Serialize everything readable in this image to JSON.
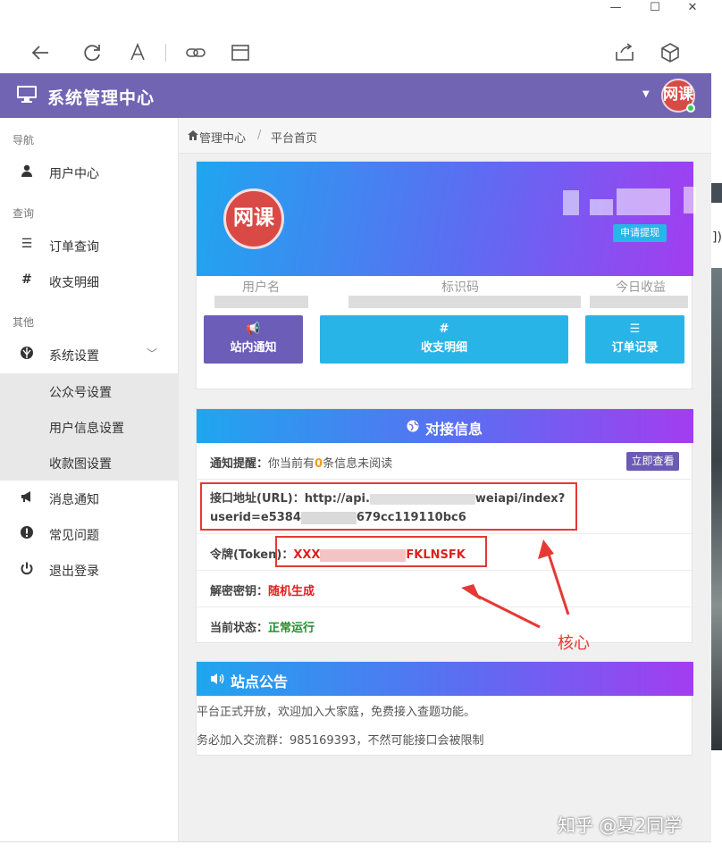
{
  "window": {
    "minimize": "—",
    "maximize": "☐",
    "close": "✕"
  },
  "app": {
    "title": "系统管理中心",
    "avatar_text": "网课"
  },
  "sidebar": {
    "sections": {
      "nav": "导航",
      "query": "查询",
      "other": "其他"
    },
    "items": {
      "user_center": "用户中心",
      "order_query": "订单查询",
      "finance": "收支明细",
      "settings": "系统设置",
      "wechat_settings": "公众号设置",
      "user_info_settings": "用户信息设置",
      "payment_qr_settings": "收款图设置",
      "messages": "消息通知",
      "faq": "常见问题",
      "logout": "退出登录"
    }
  },
  "breadcrumb": {
    "home": "管理中心",
    "sep": "/",
    "current": "平台首页"
  },
  "profile": {
    "logo_text": "网课",
    "withdraw_button": "申请提现",
    "labels": {
      "username": "用户名",
      "id_code": "标识码",
      "today_income": "今日收益"
    },
    "tiles": {
      "notice": {
        "icon": "📢",
        "label": "站内通知"
      },
      "finance": {
        "icon": "#",
        "label": "收支明细"
      },
      "orders": {
        "icon": "☰",
        "label": "订单记录"
      }
    }
  },
  "api_info": {
    "title": "对接信息",
    "notify_key": "通知提醒：",
    "notify_prefix": "你当前有",
    "notify_count": "0",
    "notify_suffix": "条信息未阅读",
    "view_button": "立即查看",
    "url_key": "接口地址(URL)：",
    "url_value_line1_start": "http://api.",
    "url_value_line1_end": "weiapi/index?",
    "url_value_line2_start": "userid=e5384",
    "url_value_line2_end": "679cc119110bc6",
    "token_key": "令牌(Token)：",
    "token_start": "XXX",
    "token_end": "FKLNSFK",
    "secret_key": "解密密钥：",
    "secret_value": "随机生成",
    "status_key": "当前状态：",
    "status_value": "正常运行"
  },
  "announcement": {
    "title": "站点公告",
    "lines": [
      "平台正式开放，欢迎加入大家庭，免费接入查题功能。",
      "务必加入交流群：985169393，不然可能接口会被限制"
    ]
  },
  "annotation": {
    "label": "核心"
  },
  "watermark": "知乎 @夏2同学",
  "right_strip_text": "])"
}
